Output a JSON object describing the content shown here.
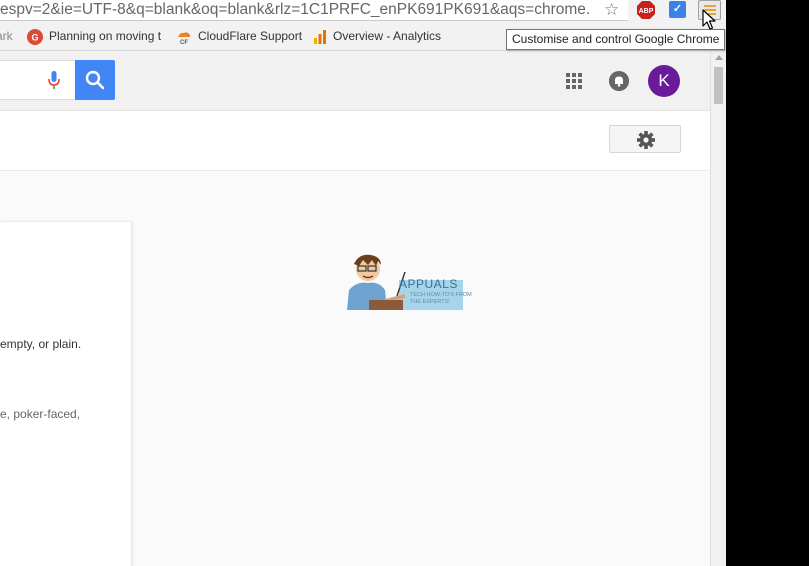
{
  "browser": {
    "url": "espv=2&ie=UTF-8&q=blank&oq=blank&rlz=1C1PRFC_enPK691PK691&aqs=chrome.",
    "extensions": [
      "abp-icon",
      "checkmark-extension-icon"
    ],
    "abp_label": "ABP",
    "menu_tooltip": "Customise and control Google Chrome"
  },
  "bookmarks": [
    {
      "label": "ark",
      "icon": "bookmark-icon"
    },
    {
      "label": "Planning on moving t",
      "icon": "google-plus-icon"
    },
    {
      "label": "CloudFlare Support",
      "icon": "cloudflare-icon"
    },
    {
      "label": "Overview - Analytics",
      "icon": "analytics-icon"
    }
  ],
  "header": {
    "avatar_letter": "K",
    "avatar_color": "#6a1b9a",
    "search_button_color": "#4285f4"
  },
  "definitions": {
    "line1": "empty, or plain.",
    "line2": "e, poker-faced,"
  },
  "watermark": {
    "title": "APPUALS",
    "tagline_1": "TECH HOW-TO'S FROM",
    "tagline_2": "THE EXPERTS!"
  }
}
